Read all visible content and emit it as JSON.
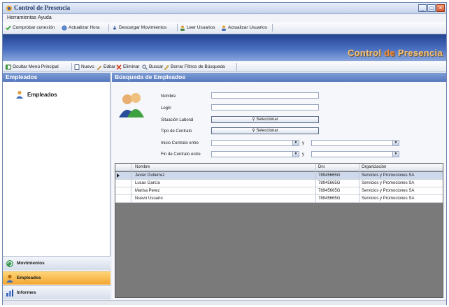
{
  "window": {
    "title": "Control de Presencia"
  },
  "menu": [
    "Herramientas",
    "Ayuda"
  ],
  "toolbar1": [
    {
      "label": "Comprobar conexión",
      "icon": "check-icon"
    },
    {
      "label": "Actualizar Hora",
      "icon": "refresh-clock-icon"
    },
    {
      "label": "Descargar Movimientos",
      "icon": "download-icon"
    },
    {
      "label": "Leer Usuarios",
      "icon": "users-read-icon"
    },
    {
      "label": "Actualizar Usuarios",
      "icon": "users-update-icon"
    }
  ],
  "banner": {
    "logo_part1": "Control ",
    "logo_part2": "de",
    "logo_part3": " Presencia"
  },
  "toolbar2": [
    {
      "label": "Ocultar Menú Principal",
      "icon": "hide-menu-icon"
    },
    {
      "label": "Nuevo",
      "icon": "new-icon"
    },
    {
      "label": "Editar",
      "icon": "edit-icon"
    },
    {
      "label": "Eliminar",
      "icon": "delete-icon"
    },
    {
      "label": "Buscar",
      "icon": "search-icon"
    },
    {
      "label": "Borrar Filtros de Búsqueda",
      "icon": "clear-filter-icon"
    }
  ],
  "sidebar": {
    "header": "Empleados",
    "tree_item": "Empleados",
    "nav": [
      {
        "label": "Movimientos",
        "active": false
      },
      {
        "label": "Empleados",
        "active": true
      },
      {
        "label": "Informes",
        "active": false
      }
    ]
  },
  "search": {
    "header": "Búsqueda de Empleados",
    "labels": {
      "nombre": "Nombre",
      "login": "Login",
      "situacion": "Situación Laboral",
      "contrato": "Tipo de Contrato",
      "inicio": "Inicio Contrato entre",
      "fin": "Fin de Contrato entre"
    },
    "select_label": "Seleccionar",
    "and_label": "y",
    "nombre_value": "",
    "login_value": ""
  },
  "grid": {
    "headers": [
      "Nombre",
      "Dni",
      "Organización"
    ],
    "rows": [
      [
        "Javier Gutierrez",
        "78945665G",
        "Servicios y Promociones SA"
      ],
      [
        "Lucas García",
        "78945665G",
        "Servicios y Promociones SA"
      ],
      [
        "Marisa Perez",
        "78945665G",
        "Servicios y Promociones SA"
      ],
      [
        "Nuevo Usuario",
        "78945665G",
        "Servicios y Promociones SA"
      ]
    ],
    "selected_row": 0
  },
  "colors": {
    "banner": "#3a5cab",
    "accent": "#f2a531",
    "header": "#5679bd"
  }
}
